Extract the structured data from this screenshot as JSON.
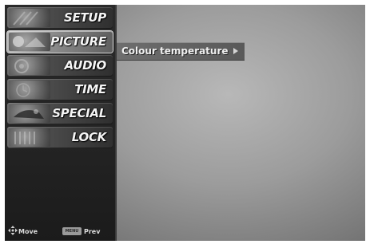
{
  "menu": {
    "items": [
      {
        "label": "SETUP",
        "icon": "setup-thumbnail-icon",
        "active": false
      },
      {
        "label": "PICTURE",
        "icon": "picture-thumbnail-icon",
        "active": true
      },
      {
        "label": "AUDIO",
        "icon": "audio-thumbnail-icon",
        "active": false
      },
      {
        "label": "TIME",
        "icon": "time-thumbnail-icon",
        "active": false
      },
      {
        "label": "SPECIAL",
        "icon": "special-thumbnail-icon",
        "active": false
      },
      {
        "label": "LOCK",
        "icon": "lock-thumbnail-icon",
        "active": false
      }
    ]
  },
  "submenu": {
    "label": "Colour temperature",
    "icon": "arrow-right-icon"
  },
  "footer": {
    "move_label": "Move",
    "move_icon": "four-way-arrow-icon",
    "menu_key_label": "MENU",
    "prev_label": "Prev"
  },
  "colors": {
    "sidebar": "#232323",
    "active_item": "#b9b9b9",
    "text": "#f4f4f4"
  }
}
